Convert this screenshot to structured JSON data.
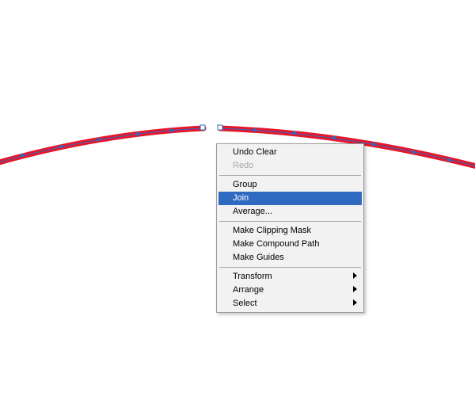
{
  "path": {
    "stroke": "#e4172d",
    "selection": "#2f6ac0",
    "anchor_fill": "#ffffff"
  },
  "menu": {
    "undo": "Undo Clear",
    "redo": "Redo",
    "group": "Group",
    "join": "Join",
    "average": "Average...",
    "clip": "Make Clipping Mask",
    "compound": "Make Compound Path",
    "guides": "Make Guides",
    "transform": "Transform",
    "arrange": "Arrange",
    "select": "Select"
  }
}
